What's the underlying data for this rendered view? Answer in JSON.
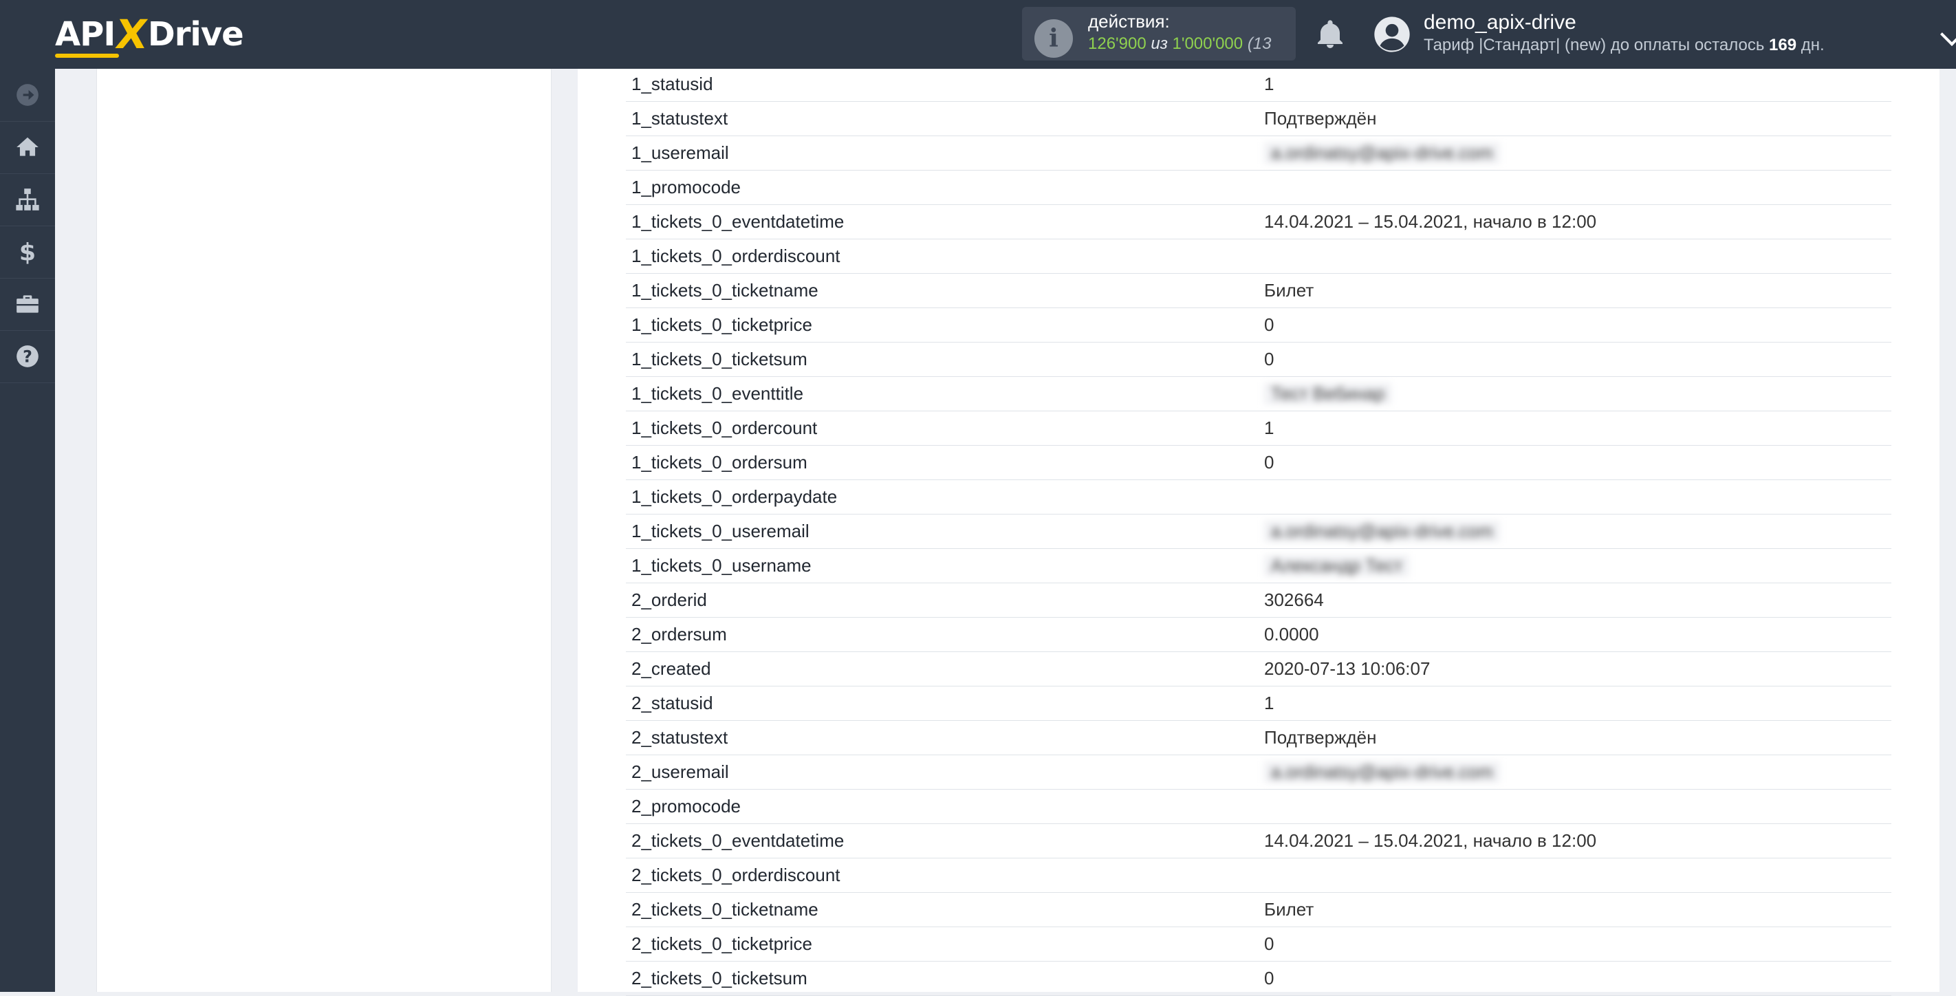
{
  "header": {
    "logo": {
      "left": "API",
      "x": "X",
      "right": "Drive"
    },
    "actions_label": "действия:",
    "actions_used": "126'900",
    "actions_of": "из",
    "actions_total": "1'000'000",
    "actions_rest": "(13",
    "username": "demo_apix-drive",
    "plan_text": "Тариф |Стандарт| (new) до оплаты осталось",
    "plan_days": "169",
    "plan_suffix": "дн."
  },
  "sidebar": {
    "items": [
      {
        "icon": "arrow-right-circle-icon"
      },
      {
        "icon": "home-icon"
      },
      {
        "icon": "sitemap-icon"
      },
      {
        "icon": "dollar-icon"
      },
      {
        "icon": "briefcase-icon"
      },
      {
        "icon": "help-icon"
      }
    ]
  },
  "rows": [
    {
      "key": "1_statusid",
      "value": "1"
    },
    {
      "key": "1_statustext",
      "value": "Подтверждён"
    },
    {
      "key": "1_useremail",
      "value": "a.ordinatsy@apix-drive.com",
      "blurred": true
    },
    {
      "key": "1_promocode",
      "value": ""
    },
    {
      "key": "1_tickets_0_eventdatetime",
      "value": "14.04.2021 – 15.04.2021, начало в 12:00"
    },
    {
      "key": "1_tickets_0_orderdiscount",
      "value": ""
    },
    {
      "key": "1_tickets_0_ticketname",
      "value": "Билет"
    },
    {
      "key": "1_tickets_0_ticketprice",
      "value": "0"
    },
    {
      "key": "1_tickets_0_ticketsum",
      "value": "0"
    },
    {
      "key": "1_tickets_0_eventtitle",
      "value": "Тест Вебинар",
      "blurred": true
    },
    {
      "key": "1_tickets_0_ordercount",
      "value": "1"
    },
    {
      "key": "1_tickets_0_ordersum",
      "value": "0"
    },
    {
      "key": "1_tickets_0_orderpaydate",
      "value": ""
    },
    {
      "key": "1_tickets_0_useremail",
      "value": "a.ordinatsy@apix-drive.com",
      "blurred": true
    },
    {
      "key": "1_tickets_0_username",
      "value": "Александр Тест",
      "blurred": true
    },
    {
      "key": "2_orderid",
      "value": "302664"
    },
    {
      "key": "2_ordersum",
      "value": "0.0000"
    },
    {
      "key": "2_created",
      "value": "2020-07-13 10:06:07"
    },
    {
      "key": "2_statusid",
      "value": "1"
    },
    {
      "key": "2_statustext",
      "value": "Подтверждён"
    },
    {
      "key": "2_useremail",
      "value": "a.ordinatsy@apix-drive.com",
      "blurred": true
    },
    {
      "key": "2_promocode",
      "value": ""
    },
    {
      "key": "2_tickets_0_eventdatetime",
      "value": "14.04.2021 – 15.04.2021, начало в 12:00"
    },
    {
      "key": "2_tickets_0_orderdiscount",
      "value": ""
    },
    {
      "key": "2_tickets_0_ticketname",
      "value": "Билет"
    },
    {
      "key": "2_tickets_0_ticketprice",
      "value": "0"
    },
    {
      "key": "2_tickets_0_ticketsum",
      "value": "0"
    }
  ]
}
